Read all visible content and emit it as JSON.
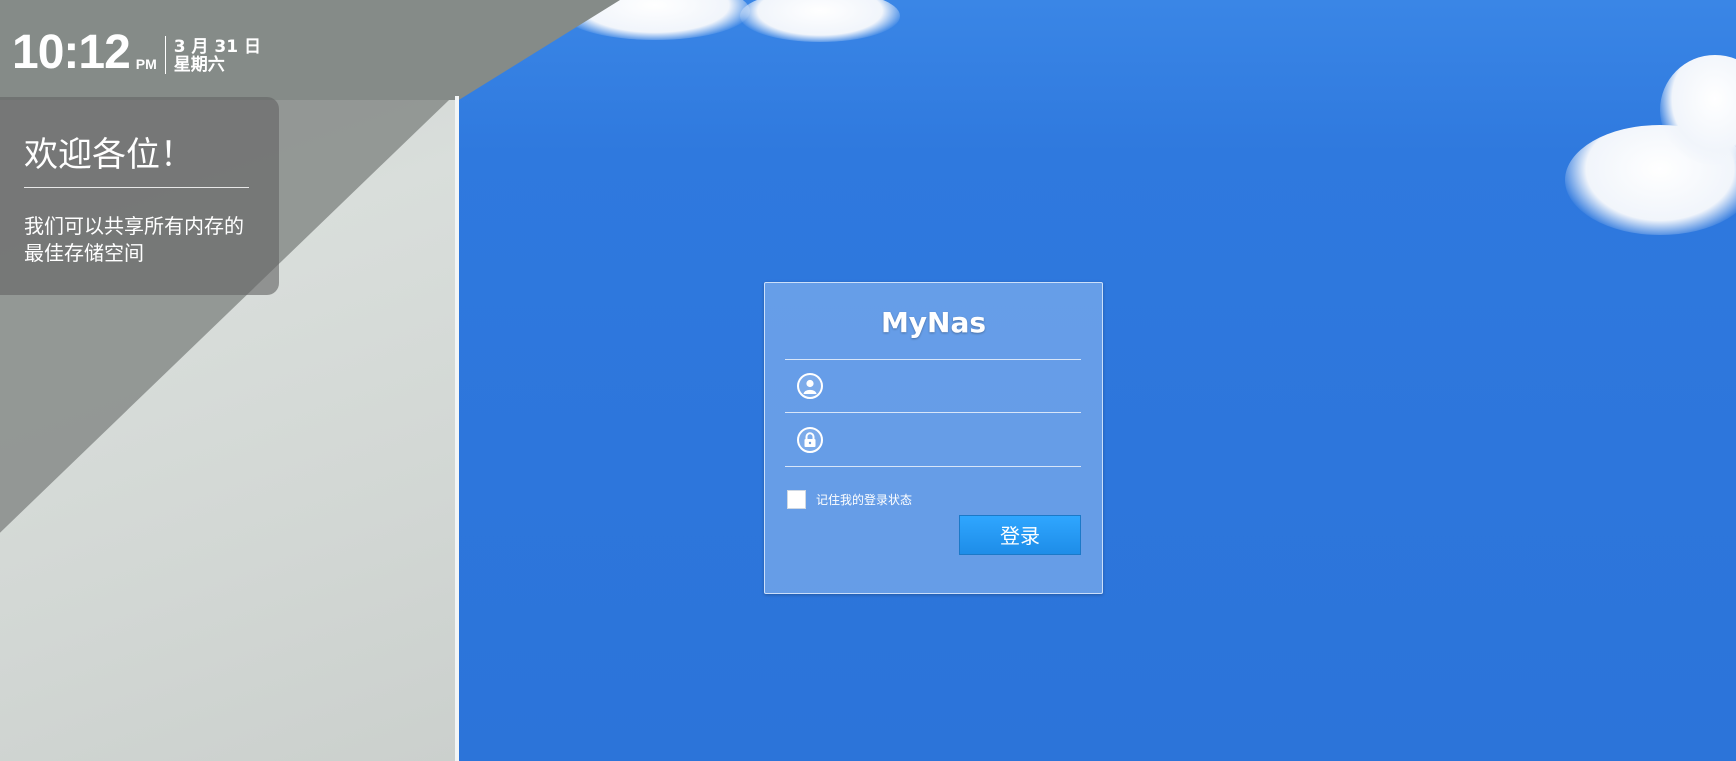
{
  "clock": {
    "time": "10:12",
    "ampm": "PM",
    "date": "3 月 31 日",
    "weekday": "星期六"
  },
  "welcome": {
    "title": "欢迎各位！",
    "description": "我们可以共享所有内存的最佳存储空间"
  },
  "login": {
    "brand": "MyNas",
    "username": {
      "icon": "user-icon",
      "value": "",
      "placeholder": ""
    },
    "password": {
      "icon": "lock-icon",
      "value": "",
      "placeholder": ""
    },
    "remember_label": "记住我的登录状态",
    "remember_checked": false,
    "submit_label": "登录"
  },
  "colors": {
    "sky": "#2d76dc",
    "button": "#2196f3"
  }
}
